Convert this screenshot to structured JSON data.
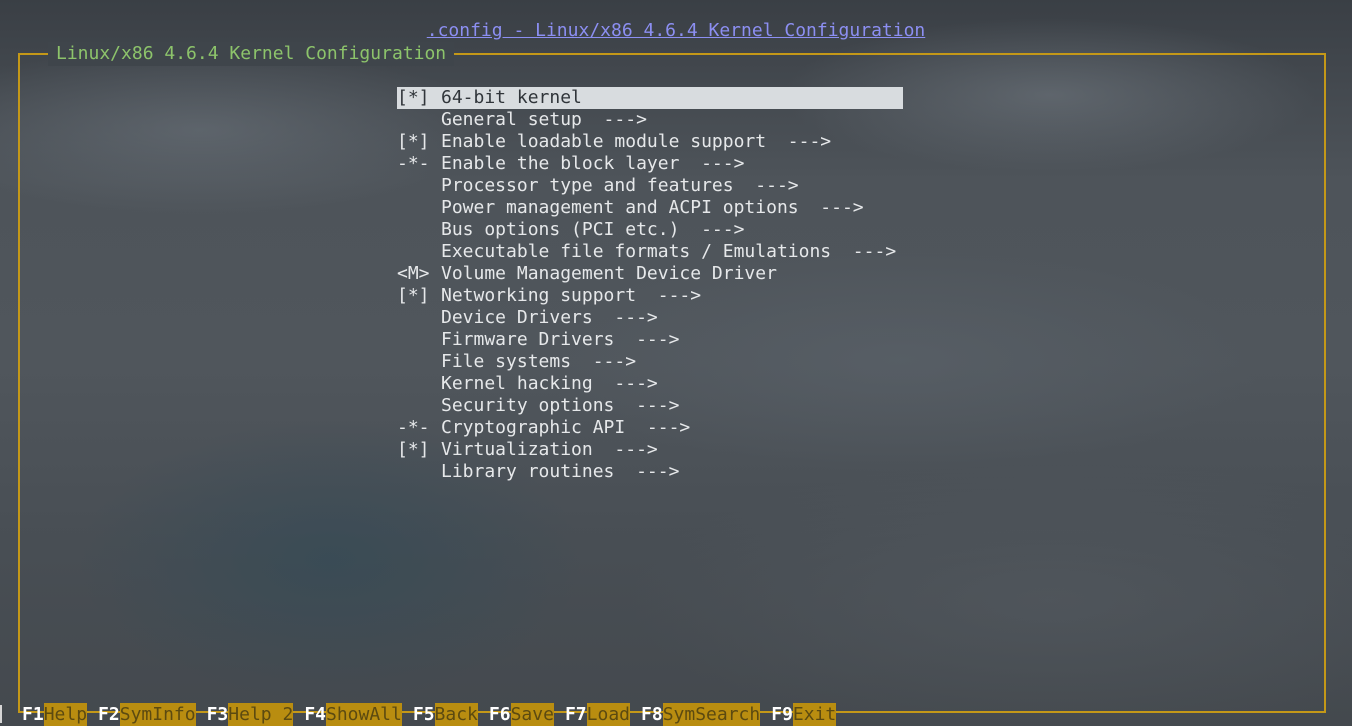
{
  "window": {
    "title": ".config - Linux/x86 4.6.4 Kernel Configuration"
  },
  "dialog": {
    "title": "Linux/x86 4.6.4 Kernel Configuration"
  },
  "menu": {
    "selected_index": 0,
    "items": [
      {
        "mark": "[*]",
        "label": "64-bit kernel"
      },
      {
        "mark": "",
        "label": "General setup  --->"
      },
      {
        "mark": "[*]",
        "label": "Enable loadable module support  --->"
      },
      {
        "mark": "-*-",
        "label": "Enable the block layer  --->"
      },
      {
        "mark": "",
        "label": "Processor type and features  --->"
      },
      {
        "mark": "",
        "label": "Power management and ACPI options  --->"
      },
      {
        "mark": "",
        "label": "Bus options (PCI etc.)  --->"
      },
      {
        "mark": "",
        "label": "Executable file formats / Emulations  --->"
      },
      {
        "mark": "<M>",
        "label": "Volume Management Device Driver"
      },
      {
        "mark": "[*]",
        "label": "Networking support  --->"
      },
      {
        "mark": "",
        "label": "Device Drivers  --->"
      },
      {
        "mark": "",
        "label": "Firmware Drivers  --->"
      },
      {
        "mark": "",
        "label": "File systems  --->"
      },
      {
        "mark": "",
        "label": "Kernel hacking  --->"
      },
      {
        "mark": "",
        "label": "Security options  --->"
      },
      {
        "mark": "-*-",
        "label": "Cryptographic API  --->"
      },
      {
        "mark": "[*]",
        "label": "Virtualization  --->"
      },
      {
        "mark": "",
        "label": "Library routines  --->"
      }
    ]
  },
  "function_keys": [
    {
      "key": "F1",
      "label": "Help"
    },
    {
      "key": "F2",
      "label": "SymInfo"
    },
    {
      "key": "F3",
      "label": "Help 2"
    },
    {
      "key": "F4",
      "label": "ShowAll"
    },
    {
      "key": "F5",
      "label": "Back"
    },
    {
      "key": "F6",
      "label": "Save"
    },
    {
      "key": "F7",
      "label": "Load"
    },
    {
      "key": "F8",
      "label": "SymSearch"
    },
    {
      "key": "F9",
      "label": "Exit"
    }
  ],
  "colors": {
    "frame_border": "#c49818",
    "dialog_title": "#8dc46b",
    "window_title": "#8c8ff2",
    "selection_bg": "#d8dcdf",
    "fkey_label_bg": "#b98d10"
  }
}
